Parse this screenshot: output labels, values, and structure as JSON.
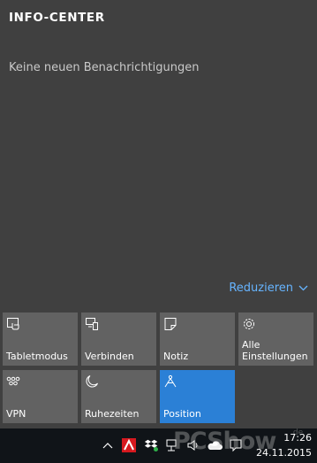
{
  "action_center": {
    "title": "INFO-CENTER",
    "empty_message": "Keine neuen Benachrichtigungen",
    "collapse_label": "Reduzieren"
  },
  "quick_actions": [
    {
      "label": "Tabletmodus",
      "icon": "tablet-mode-icon",
      "active": false
    },
    {
      "label": "Verbinden",
      "icon": "connect-icon",
      "active": false
    },
    {
      "label": "Notiz",
      "icon": "note-icon",
      "active": false
    },
    {
      "label": "Alle Einstellungen",
      "icon": "settings-gear-icon",
      "active": false
    },
    {
      "label": "VPN",
      "icon": "vpn-icon",
      "active": false
    },
    {
      "label": "Ruhezeiten",
      "icon": "moon-icon",
      "active": false
    },
    {
      "label": "Position",
      "icon": "location-icon",
      "active": true
    }
  ],
  "taskbar": {
    "time": "17:26",
    "date": "24.11.2015",
    "tray_icons": [
      "chevron-up-icon",
      "avira-icon",
      "dropbox-icon",
      "network-icon",
      "volume-icon",
      "onedrive-icon",
      "notification-icon"
    ]
  },
  "watermark": {
    "text": "PCShow",
    "suffix": ".de"
  },
  "colors": {
    "accent": "#2b80d6",
    "link": "#66b4ff",
    "tile": "#626262",
    "panel": "#404040"
  }
}
